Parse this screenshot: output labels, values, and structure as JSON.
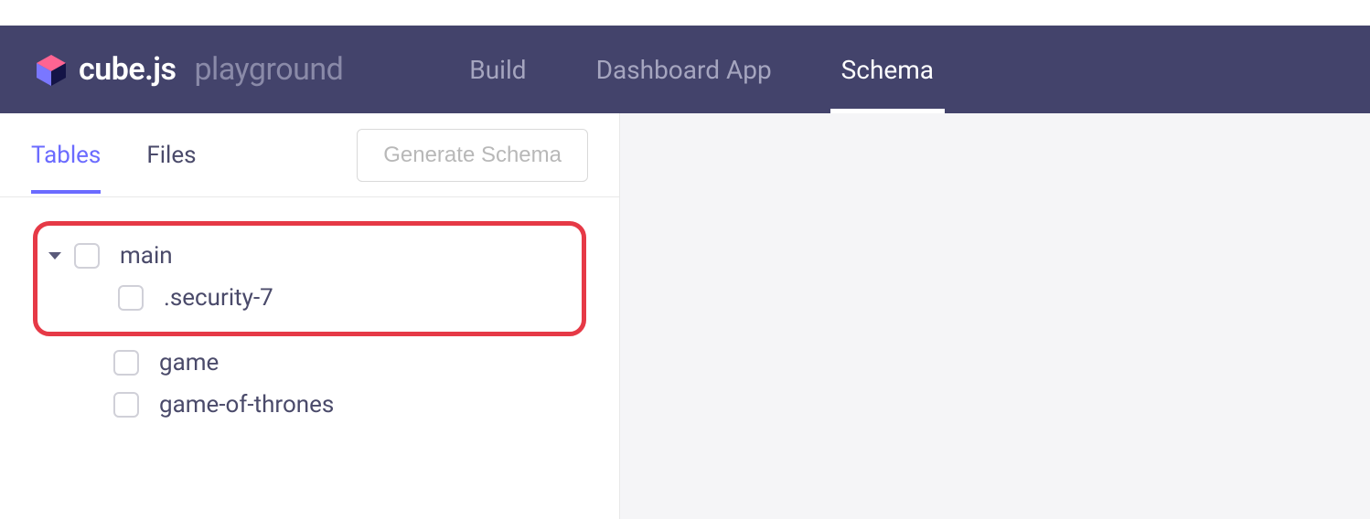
{
  "brand": {
    "name": "cube.js",
    "suffix": "playground"
  },
  "nav": {
    "items": [
      {
        "label": "Build",
        "active": false
      },
      {
        "label": "Dashboard App",
        "active": false
      },
      {
        "label": "Schema",
        "active": true
      }
    ]
  },
  "sidebar": {
    "tabs": [
      {
        "label": "Tables",
        "active": true
      },
      {
        "label": "Files",
        "active": false
      }
    ],
    "generate_button": "Generate Schema"
  },
  "tree": {
    "root": {
      "label": "main",
      "expanded": true
    },
    "children": [
      {
        "label": ".security-7"
      },
      {
        "label": "game"
      },
      {
        "label": "game-of-thrones"
      }
    ]
  }
}
